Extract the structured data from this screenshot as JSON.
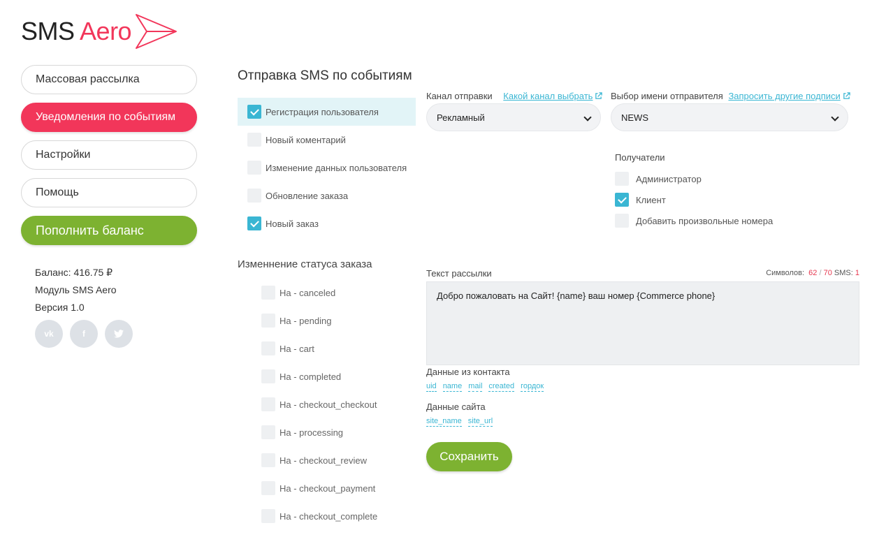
{
  "brand": {
    "name_part1": "SMS",
    "name_part2": "Aero",
    "accent_color": "#f2365a",
    "action_color": "#7db231",
    "check_color": "#3ab6d3"
  },
  "sidebar": {
    "items": [
      {
        "label": "Массовая рассылка"
      },
      {
        "label": "Уведомления по событиям"
      },
      {
        "label": "Настройки"
      },
      {
        "label": "Помощь"
      },
      {
        "label": "Пополнить баланс"
      }
    ],
    "balance": "Баланс: 416.75 ₽",
    "module": "Модуль SMS Aero",
    "version": "Версия 1.0",
    "socials": [
      {
        "icon": "vk-icon",
        "glyph": "vk"
      },
      {
        "icon": "facebook-icon",
        "glyph": "f"
      },
      {
        "icon": "twitter-icon",
        "glyph": "t"
      }
    ]
  },
  "main": {
    "title": "Отправка SMS по событиям",
    "events": [
      {
        "label": "Регистрация пользователя",
        "checked": true
      },
      {
        "label": "Новый коментарий",
        "checked": false
      },
      {
        "label": "Изменение данных пользователя",
        "checked": false
      },
      {
        "label": "Обновление заказа",
        "checked": false
      },
      {
        "label": "Новый заказ",
        "checked": true
      }
    ],
    "status_title": "Изменнение статуса заказа",
    "statuses": [
      {
        "label": "На - canceled",
        "checked": false
      },
      {
        "label": "На - pending",
        "checked": false
      },
      {
        "label": "На - cart",
        "checked": false
      },
      {
        "label": "На - completed",
        "checked": false
      },
      {
        "label": "На - checkout_checkout",
        "checked": false
      },
      {
        "label": "На - processing",
        "checked": false
      },
      {
        "label": "На - checkout_review",
        "checked": false
      },
      {
        "label": "На - checkout_payment",
        "checked": false
      },
      {
        "label": "На - checkout_complete",
        "checked": false
      }
    ],
    "channel": {
      "label": "Канал отправки",
      "link": "Какой канал выбрать",
      "value": "Рекламный"
    },
    "sender": {
      "label": "Выбор имени отправителя",
      "link": "Запросить другие подписи",
      "value": "NEWS"
    },
    "recipients": {
      "title": "Получатели",
      "items": [
        {
          "label": "Администратор",
          "checked": false
        },
        {
          "label": "Клиент",
          "checked": true
        },
        {
          "label": "Добавить произвольные номера",
          "checked": false
        }
      ]
    },
    "message": {
      "label": "Текст рассылки",
      "counter_prefix": "Символов:",
      "chars": "62",
      "sep": "/",
      "limit": "70",
      "sms_label": "SMS:",
      "sms_count": "1",
      "text": "Добро пожаловать на Сайт!  {name}  ваш номер {Commerce phone}"
    },
    "contact_vars": {
      "label": "Данные из контакта",
      "items": [
        "uid",
        "name",
        "mail",
        "created",
        "гордок"
      ]
    },
    "site_vars": {
      "label": "Данные сайта",
      "items": [
        "site_name",
        "site_url"
      ]
    },
    "save_label": "Сохранить"
  }
}
